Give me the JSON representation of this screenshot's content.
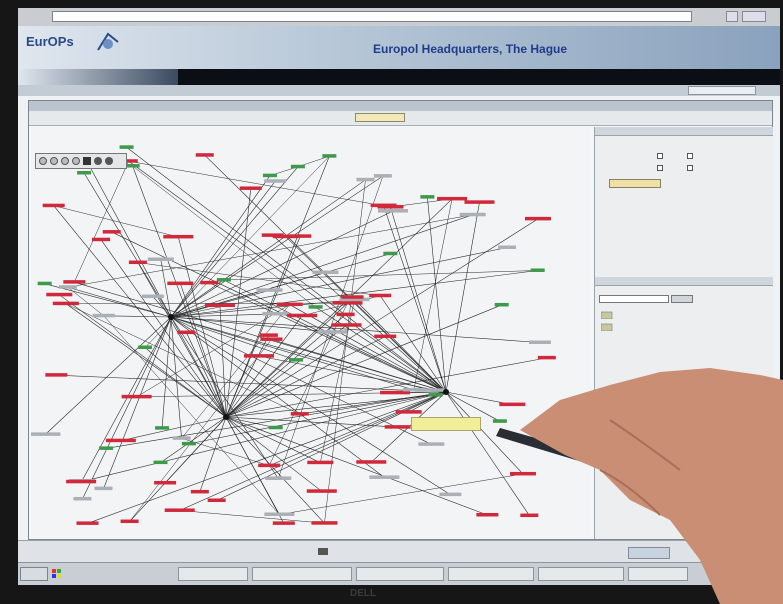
{
  "browser": {
    "address_label": "",
    "address": ""
  },
  "banner": {
    "logo_text": "EurOPs",
    "hq_title": "Europol Headquarters, The Hague"
  },
  "nav": {
    "items": []
  },
  "strip_button": "",
  "app": {
    "title": "",
    "toolbar_labels": [],
    "graph_caption": ""
  },
  "right_panel": {
    "section1_title": "",
    "section2_title": "",
    "labels": []
  },
  "bottom_panel": {
    "left_text": "",
    "mid_text": ""
  },
  "taskbar": {
    "start": "",
    "items": []
  },
  "monitor_brand": "DELL",
  "colors": {
    "node_red": "#d2283c",
    "node_green": "#3c9a4a",
    "edge": "#2a2a2a",
    "tooltip_yellow": "#f1ee9a",
    "banner_blue": "#1f3c8a"
  },
  "icons": [
    "windows-logo-icon",
    "zoom-icon",
    "pan-icon",
    "back-arrow-icon",
    "forward-arrow-icon",
    "folder-icon"
  ]
}
